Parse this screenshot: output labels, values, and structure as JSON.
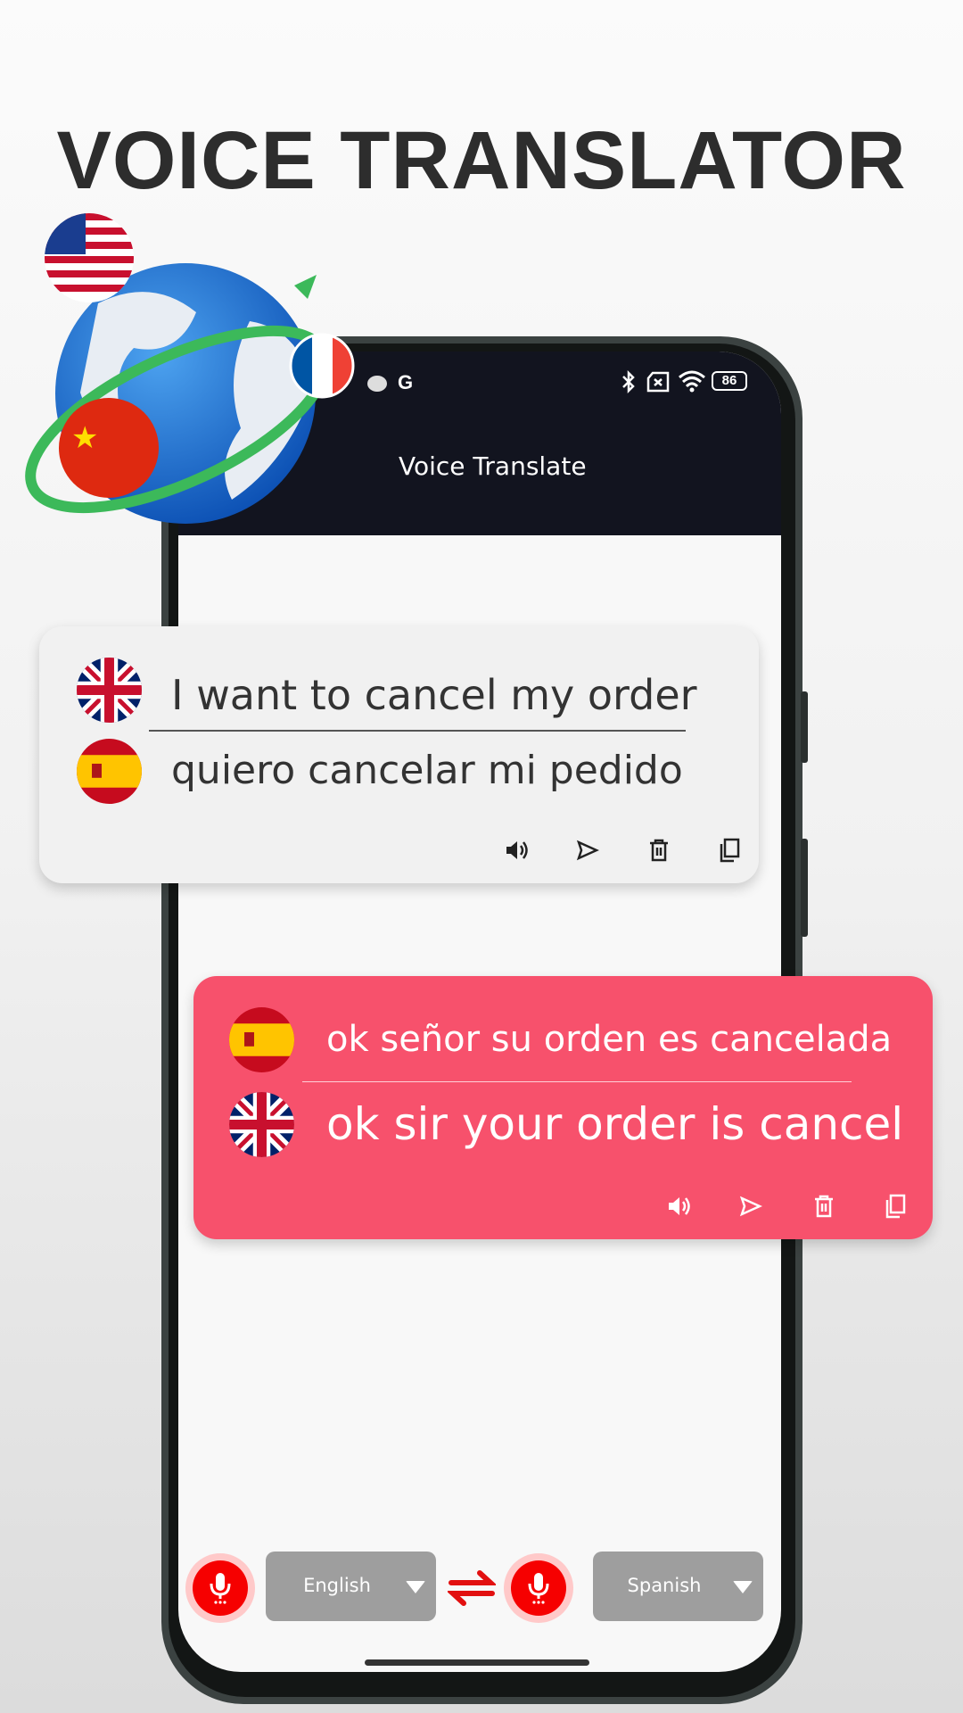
{
  "headline": "VOICE TRANSLATOR",
  "status_bar": {
    "left_icons": [
      "weather-icon",
      "google-icon"
    ],
    "google_letter": "G",
    "battery": "86",
    "right_icons": [
      "bluetooth-icon",
      "no-sim-icon",
      "wifi-icon",
      "battery-icon"
    ]
  },
  "app": {
    "title": "Voice Translate"
  },
  "card_outgoing": {
    "source_flag": "uk-flag",
    "source_text": "I want to cancel my order",
    "target_flag": "spain-flag",
    "target_text": "quiero cancelar mi pedido",
    "background": "#f1f1f1",
    "actions": [
      "speaker-icon",
      "send-icon",
      "trash-icon",
      "copy-icon"
    ]
  },
  "card_incoming": {
    "source_flag": "spain-flag",
    "source_text": "ok señor su orden es cancelada",
    "target_flag": "uk-flag",
    "target_text": "ok sir your order is cancel",
    "background": "#f7516c",
    "actions": [
      "speaker-icon",
      "send-icon",
      "trash-icon",
      "copy-icon"
    ]
  },
  "bottom_bar": {
    "source_language": "English",
    "target_language": "Spanish",
    "accent": "#f60000"
  },
  "illustration": {
    "flags": [
      "usa-flag",
      "china-flag",
      "france-flag"
    ],
    "object": "globe-icon"
  }
}
